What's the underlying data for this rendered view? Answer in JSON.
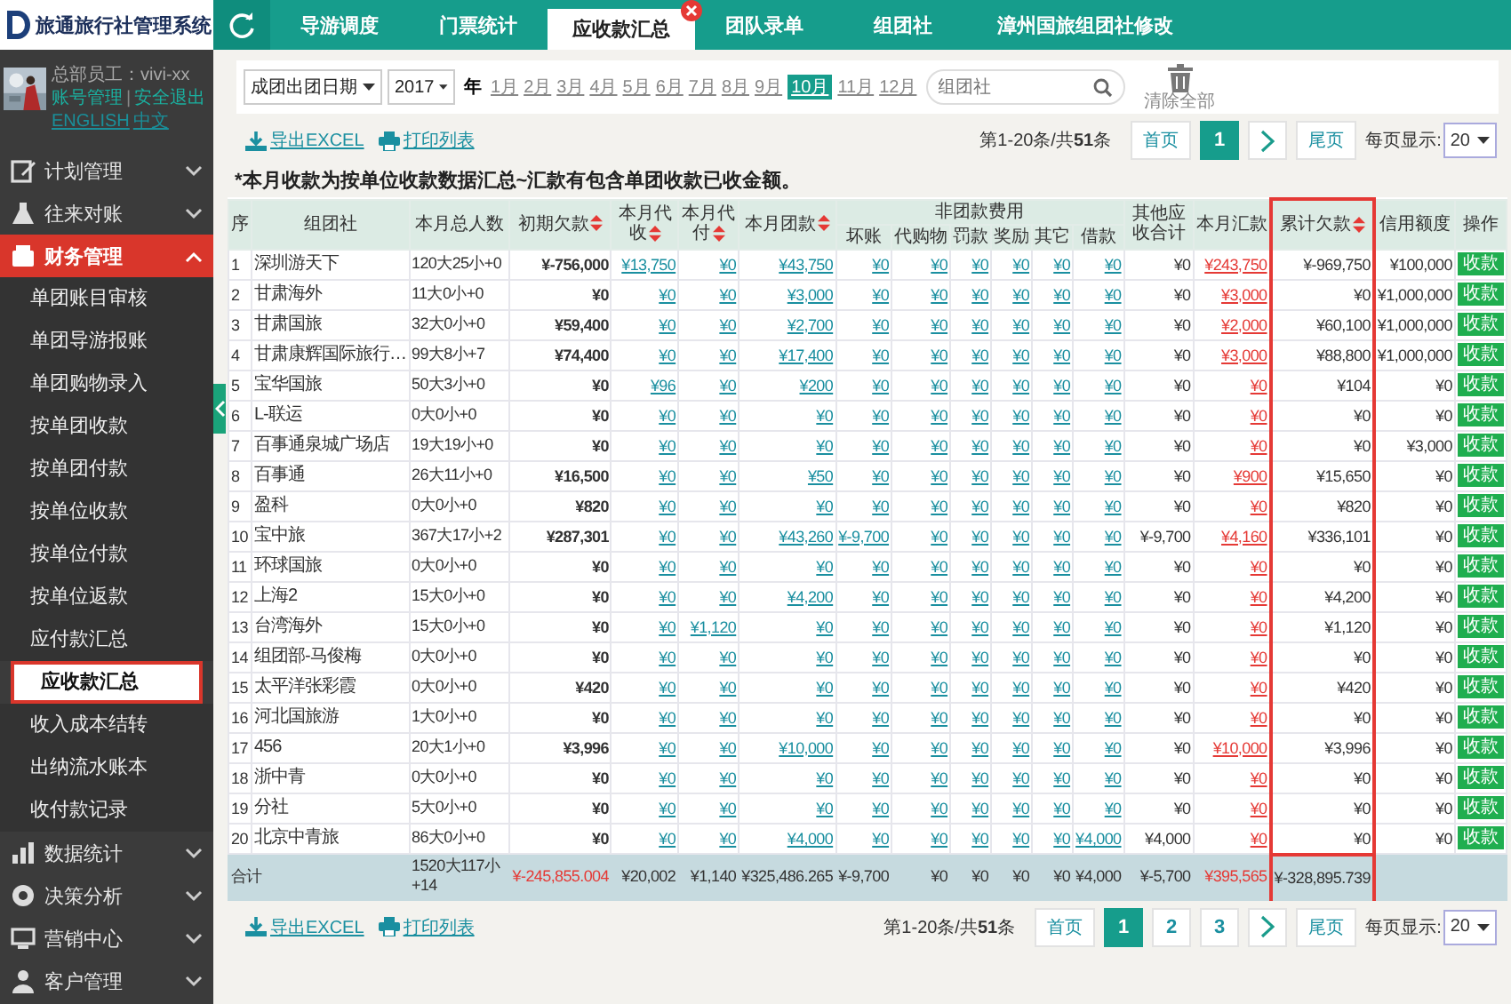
{
  "logo": {
    "title": "旅通旅行社管理系统"
  },
  "user": {
    "greeting": "总部员工：vivi-xx",
    "account_link": "账号管理",
    "separator": "|",
    "logout_link": "安全退出",
    "languages": [
      "ENGLISH",
      "中文"
    ]
  },
  "sidebar": {
    "items": [
      {
        "label": "计划管理",
        "expanded": false
      },
      {
        "label": "往来对账",
        "expanded": false
      },
      {
        "label": "财务管理",
        "expanded": true,
        "children": [
          {
            "label": "单团账目审核",
            "selected": false
          },
          {
            "label": "单团导游报账",
            "selected": false
          },
          {
            "label": "单团购物录入",
            "selected": false
          },
          {
            "label": "按单团收款",
            "selected": false
          },
          {
            "label": "按单团付款",
            "selected": false
          },
          {
            "label": "按单位收款",
            "selected": false
          },
          {
            "label": "按单位付款",
            "selected": false
          },
          {
            "label": "按单位返款",
            "selected": false
          },
          {
            "label": "应付款汇总",
            "selected": false
          },
          {
            "label": "应收款汇总",
            "selected": true
          },
          {
            "label": "收入成本结转",
            "selected": false
          },
          {
            "label": "出纳流水账本",
            "selected": false
          },
          {
            "label": "收付款记录",
            "selected": false
          }
        ]
      },
      {
        "label": "数据统计",
        "expanded": false
      },
      {
        "label": "决策分析",
        "expanded": false
      },
      {
        "label": "营销中心",
        "expanded": false
      },
      {
        "label": "客户管理",
        "expanded": false
      }
    ]
  },
  "tabs": [
    {
      "label": "导游调度",
      "selected": false
    },
    {
      "label": "门票统计",
      "selected": false
    },
    {
      "label": "应收款汇总",
      "selected": true
    },
    {
      "label": "团队录单",
      "selected": false
    },
    {
      "label": "组团社",
      "selected": false
    },
    {
      "label": "漳州国旅组团社修改",
      "selected": false
    }
  ],
  "filter": {
    "date_field": "成团出团日期",
    "year": "2017",
    "year_label": "年",
    "months": [
      {
        "label": "1月",
        "selected": false
      },
      {
        "label": "2月",
        "selected": false
      },
      {
        "label": "3月",
        "selected": false
      },
      {
        "label": "4月",
        "selected": false
      },
      {
        "label": "5月",
        "selected": false
      },
      {
        "label": "6月",
        "selected": false
      },
      {
        "label": "7月",
        "selected": false
      },
      {
        "label": "8月",
        "selected": false
      },
      {
        "label": "9月",
        "selected": false
      },
      {
        "label": "10月",
        "selected": true
      },
      {
        "label": "11月",
        "selected": false
      },
      {
        "label": "12月",
        "selected": false
      }
    ],
    "search": {
      "placeholder": "组团社"
    },
    "clear_label": "清除全部"
  },
  "top_toolbar": {
    "export": "导出EXCEL",
    "print": "打印列表",
    "pager": {
      "summary": "第1-20条/共**51**条",
      "first": "首页",
      "pages": [
        {
          "label": "1",
          "selected": true
        }
      ],
      "last": "尾页",
      "page_size_label": "每页显示:",
      "page_size": "20"
    }
  },
  "note": "*本月收款为按单位收款数据汇总~汇款有包含单团收款已收金额。",
  "table": {
    "columns": [
      {
        "label": "序",
        "kind": "plain",
        "sortable": false,
        "highlighted": false
      },
      {
        "label": "组团社",
        "kind": "name",
        "sortable": false,
        "highlighted": false
      },
      {
        "label": "本月总人数",
        "kind": "plain",
        "sortable": false,
        "highlighted": false
      },
      {
        "label": "初期欠款",
        "kind": "red",
        "sortable": true,
        "highlighted": false
      },
      {
        "label": "本月代收",
        "kind": "link",
        "sortable": true,
        "highlighted": false
      },
      {
        "label": "本月代付",
        "kind": "link",
        "sortable": true,
        "highlighted": false
      },
      {
        "label": "本月团款",
        "kind": "link",
        "sortable": true,
        "highlighted": false
      },
      {
        "label": "坏账",
        "kind": "link",
        "sortable": false,
        "highlighted": false,
        "grouped": true
      },
      {
        "label": "代购物",
        "kind": "link",
        "sortable": false,
        "highlighted": false,
        "grouped": true
      },
      {
        "label": "罚款",
        "kind": "link",
        "sortable": false,
        "highlighted": false,
        "grouped": true
      },
      {
        "label": "奖励",
        "kind": "link",
        "sortable": false,
        "highlighted": false,
        "grouped": true
      },
      {
        "label": "其它",
        "kind": "link",
        "sortable": false,
        "highlighted": false,
        "grouped": true
      },
      {
        "label": "借款",
        "kind": "link",
        "sortable": false,
        "highlighted": false,
        "grouped": true
      },
      {
        "label": "其他应收合计",
        "kind": "number",
        "sortable": false,
        "highlighted": false
      },
      {
        "label": "本月汇款",
        "kind": "red-link",
        "sortable": false,
        "highlighted": false
      },
      {
        "label": "累计欠款",
        "kind": "number",
        "sortable": true,
        "highlighted": true
      },
      {
        "label": "信用额度",
        "kind": "number",
        "sortable": false,
        "highlighted": false
      },
      {
        "label": "操作",
        "kind": "button",
        "sortable": false,
        "highlighted": false
      }
    ],
    "column_group": {
      "label": "非团款费用"
    },
    "rows": [
      {
        "cells": [
          "1",
          "深圳游天下",
          "120大25小+0",
          "¥-756,000",
          "¥13,750",
          "¥0",
          "¥43,750",
          "¥0",
          "¥0",
          "¥0",
          "¥0",
          "¥0",
          "¥0",
          "¥0",
          "¥243,750",
          "¥-969,750",
          "¥100,000",
          "收款"
        ]
      },
      {
        "cells": [
          "2",
          "甘肃海外",
          "11大0小+0",
          "¥0",
          "¥0",
          "¥0",
          "¥3,000",
          "¥0",
          "¥0",
          "¥0",
          "¥0",
          "¥0",
          "¥0",
          "¥0",
          "¥3,000",
          "¥0",
          "¥1,000,000",
          "收款"
        ]
      },
      {
        "cells": [
          "3",
          "甘肃国旅",
          "32大0小+0",
          "¥59,400",
          "¥0",
          "¥0",
          "¥2,700",
          "¥0",
          "¥0",
          "¥0",
          "¥0",
          "¥0",
          "¥0",
          "¥0",
          "¥2,000",
          "¥60,100",
          "¥1,000,000",
          "收款"
        ]
      },
      {
        "cells": [
          "4",
          "甘肃康辉国际旅行…",
          "99大8小+7",
          "¥74,400",
          "¥0",
          "¥0",
          "¥17,400",
          "¥0",
          "¥0",
          "¥0",
          "¥0",
          "¥0",
          "¥0",
          "¥0",
          "¥3,000",
          "¥88,800",
          "¥1,000,000",
          "收款"
        ]
      },
      {
        "cells": [
          "5",
          "宝华国旅",
          "50大3小+0",
          "¥0",
          "¥96",
          "¥0",
          "¥200",
          "¥0",
          "¥0",
          "¥0",
          "¥0",
          "¥0",
          "¥0",
          "¥0",
          "¥0",
          "¥104",
          "¥0",
          "收款"
        ]
      },
      {
        "cells": [
          "6",
          "L-联运",
          "0大0小+0",
          "¥0",
          "¥0",
          "¥0",
          "¥0",
          "¥0",
          "¥0",
          "¥0",
          "¥0",
          "¥0",
          "¥0",
          "¥0",
          "¥0",
          "¥0",
          "¥0",
          "收款"
        ]
      },
      {
        "cells": [
          "7",
          "百事通泉城广场店",
          "19大19小+0",
          "¥0",
          "¥0",
          "¥0",
          "¥0",
          "¥0",
          "¥0",
          "¥0",
          "¥0",
          "¥0",
          "¥0",
          "¥0",
          "¥0",
          "¥0",
          "¥3,000",
          "收款"
        ]
      },
      {
        "cells": [
          "8",
          "百事通",
          "26大11小+0",
          "¥16,500",
          "¥0",
          "¥0",
          "¥50",
          "¥0",
          "¥0",
          "¥0",
          "¥0",
          "¥0",
          "¥0",
          "¥0",
          "¥900",
          "¥15,650",
          "¥0",
          "收款"
        ]
      },
      {
        "cells": [
          "9",
          "盈科",
          "0大0小+0",
          "¥820",
          "¥0",
          "¥0",
          "¥0",
          "¥0",
          "¥0",
          "¥0",
          "¥0",
          "¥0",
          "¥0",
          "¥0",
          "¥0",
          "¥820",
          "¥0",
          "收款"
        ]
      },
      {
        "cells": [
          "10",
          "宝中旅",
          "367大17小+2",
          "¥287,301",
          "¥0",
          "¥0",
          "¥43,260",
          "¥-9,700",
          "¥0",
          "¥0",
          "¥0",
          "¥0",
          "¥0",
          "¥-9,700",
          "¥4,160",
          "¥336,101",
          "¥0",
          "收款"
        ]
      },
      {
        "cells": [
          "11",
          "环球国旅",
          "0大0小+0",
          "¥0",
          "¥0",
          "¥0",
          "¥0",
          "¥0",
          "¥0",
          "¥0",
          "¥0",
          "¥0",
          "¥0",
          "¥0",
          "¥0",
          "¥0",
          "¥0",
          "收款"
        ]
      },
      {
        "cells": [
          "12",
          "上海2",
          "15大0小+0",
          "¥0",
          "¥0",
          "¥0",
          "¥4,200",
          "¥0",
          "¥0",
          "¥0",
          "¥0",
          "¥0",
          "¥0",
          "¥0",
          "¥0",
          "¥4,200",
          "¥0",
          "收款"
        ]
      },
      {
        "cells": [
          "13",
          "台湾海外",
          "15大0小+0",
          "¥0",
          "¥0",
          "¥1,120",
          "¥0",
          "¥0",
          "¥0",
          "¥0",
          "¥0",
          "¥0",
          "¥0",
          "¥0",
          "¥0",
          "¥1,120",
          "¥0",
          "收款"
        ]
      },
      {
        "cells": [
          "14",
          "组团部-马俊梅",
          "0大0小+0",
          "¥0",
          "¥0",
          "¥0",
          "¥0",
          "¥0",
          "¥0",
          "¥0",
          "¥0",
          "¥0",
          "¥0",
          "¥0",
          "¥0",
          "¥0",
          "¥0",
          "收款"
        ]
      },
      {
        "cells": [
          "15",
          "太平洋张彩霞",
          "0大0小+0",
          "¥420",
          "¥0",
          "¥0",
          "¥0",
          "¥0",
          "¥0",
          "¥0",
          "¥0",
          "¥0",
          "¥0",
          "¥0",
          "¥0",
          "¥420",
          "¥0",
          "收款"
        ]
      },
      {
        "cells": [
          "16",
          "河北国旅游",
          "1大0小+0",
          "¥0",
          "¥0",
          "¥0",
          "¥0",
          "¥0",
          "¥0",
          "¥0",
          "¥0",
          "¥0",
          "¥0",
          "¥0",
          "¥0",
          "¥0",
          "¥0",
          "收款"
        ]
      },
      {
        "cells": [
          "17",
          "456",
          "20大1小+0",
          "¥3,996",
          "¥0",
          "¥0",
          "¥10,000",
          "¥0",
          "¥0",
          "¥0",
          "¥0",
          "¥0",
          "¥0",
          "¥0",
          "¥10,000",
          "¥3,996",
          "¥0",
          "收款"
        ]
      },
      {
        "cells": [
          "18",
          "浙中青",
          "0大0小+0",
          "¥0",
          "¥0",
          "¥0",
          "¥0",
          "¥0",
          "¥0",
          "¥0",
          "¥0",
          "¥0",
          "¥0",
          "¥0",
          "¥0",
          "¥0",
          "¥0",
          "收款"
        ]
      },
      {
        "cells": [
          "19",
          "分社",
          "5大0小+0",
          "¥0",
          "¥0",
          "¥0",
          "¥0",
          "¥0",
          "¥0",
          "¥0",
          "¥0",
          "¥0",
          "¥0",
          "¥0",
          "¥0",
          "¥0",
          "¥0",
          "收款"
        ]
      },
      {
        "cells": [
          "20",
          "北京中青旅",
          "86大0小+0",
          "¥0",
          "¥0",
          "¥0",
          "¥4,000",
          "¥0",
          "¥0",
          "¥0",
          "¥0",
          "¥0",
          "¥4,000",
          "¥4,000",
          "¥0",
          "¥0",
          "¥0",
          "收款"
        ]
      }
    ],
    "totals": [
      "合计",
      "1520大117小+14",
      "¥-245,855.004",
      "¥20,002",
      "¥1,140",
      "¥325,486.265",
      "¥-9,700",
      "¥0",
      "¥0",
      "¥0",
      "¥0",
      "¥4,000",
      "¥-5,700",
      "¥395,565",
      "¥-328,895.739"
    ]
  },
  "bottom_toolbar": {
    "export": "导出EXCEL",
    "print": "打印列表",
    "pager": {
      "summary": "第1-20条/共**51**条",
      "first": "首页",
      "pages": [
        {
          "label": "1",
          "selected": true
        },
        {
          "label": "2",
          "selected": false
        },
        {
          "label": "3",
          "selected": false
        }
      ],
      "last": "尾页",
      "page_size_label": "每页显示:",
      "page_size": "20"
    }
  }
}
